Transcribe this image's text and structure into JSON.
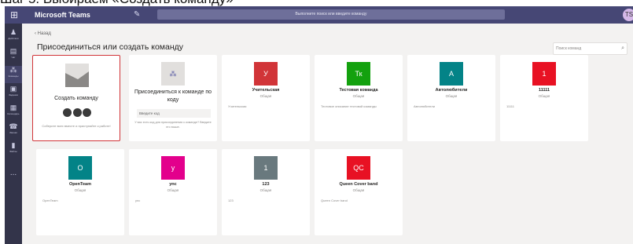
{
  "caption": "Шаг 5. Выбираем «Создать команду»",
  "topbar": {
    "app_icon": "grid-icon",
    "title": "Microsoft Teams",
    "compose_icon": "new-chat-icon",
    "search_placeholder": "Выполните поиск или введите команду",
    "avatar_initials": "TS"
  },
  "rail": [
    {
      "icon": "bell-icon",
      "label": "Действия"
    },
    {
      "icon": "chat-icon",
      "label": "Чат"
    },
    {
      "icon": "teams-icon",
      "label": "Команды",
      "active": true
    },
    {
      "icon": "assignments-icon",
      "label": "Задания"
    },
    {
      "icon": "calendar-icon",
      "label": "Календарь"
    },
    {
      "icon": "calls-icon",
      "label": "Звонки"
    },
    {
      "icon": "files-icon",
      "label": "Файлы"
    }
  ],
  "rail_more": "...",
  "back_label": "‹ Назад",
  "page_title": "Присоединиться или создать команду",
  "team_search_placeholder": "Поиск команд",
  "create_card": {
    "title": "Создать команду",
    "hint": "Соберите всех вместе и приступайте к работе!"
  },
  "join_card": {
    "title": "Присоединиться к команде по коду",
    "input_placeholder": "Введите код",
    "hint": "У вас есть код для присоединения к команде? Введите его выше."
  },
  "teams": [
    {
      "initials": "У",
      "name": "Учительская",
      "type": "Общая",
      "desc": "Учительская",
      "color": "#d13438"
    },
    {
      "initials": "Тк",
      "name": "Тестовая команда",
      "type": "Общая",
      "desc": "Тестовое описание тестовой команды",
      "color": "#13a10e"
    },
    {
      "initials": "А",
      "name": "Автолюбители",
      "type": "Общая",
      "desc": "Автолюбители",
      "color": "#038387"
    },
    {
      "initials": "1",
      "name": "11111",
      "type": "Общая",
      "desc": "11111",
      "color": "#e81123"
    },
    {
      "initials": "O",
      "name": "OpenTeam",
      "type": "Общая",
      "desc": "OpenTeam",
      "color": "#038387"
    },
    {
      "initials": "y",
      "name": "ync",
      "type": "Общая",
      "desc": "ync",
      "color": "#e3008c"
    },
    {
      "initials": "1",
      "name": "123",
      "type": "Общая",
      "desc": "123",
      "color": "#69797e"
    },
    {
      "initials": "QC",
      "name": "Queen Cover band",
      "type": "Общая",
      "desc": "Queen Cover band",
      "color": "#e81123"
    }
  ]
}
